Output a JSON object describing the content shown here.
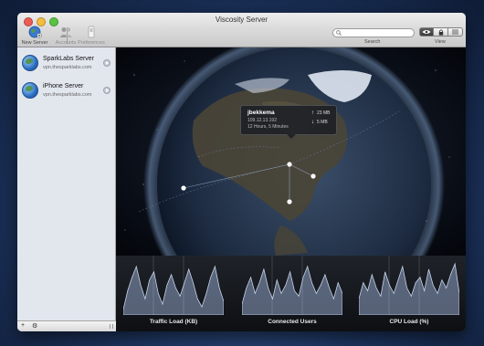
{
  "window": {
    "title": "Viscosity Server"
  },
  "toolbar": {
    "new_server_label": "New Server",
    "accounts_label": "Accounts",
    "preferences_label": "Preferences",
    "search_placeholder": "",
    "search_label": "Search",
    "view_label": "View"
  },
  "sidebar": {
    "servers": [
      {
        "name": "SparkLabs Server",
        "host": "vpn.thesparklabs.com"
      },
      {
        "name": "iPhone Server",
        "host": "vpn.thesparklabs.com"
      }
    ],
    "add_label": "+",
    "gear_label": "⚙"
  },
  "popup": {
    "user": "jbekkema",
    "ip": "109.12.13.192",
    "duration": "12 Hours, 5 Minutes",
    "up": "23 MB",
    "down": "5 MB"
  },
  "charts": {
    "traffic": {
      "title": "Traffic Load (KB)",
      "values": [
        0.1,
        0.45,
        0.7,
        0.9,
        0.55,
        0.3,
        0.65,
        0.8,
        0.4,
        0.2,
        0.55,
        0.75,
        0.5,
        0.35,
        0.6,
        0.85,
        0.6,
        0.3,
        0.15,
        0.4,
        0.7,
        0.9,
        0.5,
        0.25
      ]
    },
    "users": {
      "title": "Connected Users",
      "values": [
        0.2,
        0.5,
        0.7,
        0.4,
        0.6,
        0.85,
        0.5,
        0.3,
        0.65,
        0.4,
        0.55,
        0.8,
        0.45,
        0.35,
        0.7,
        0.9,
        0.6,
        0.4,
        0.55,
        0.75,
        0.5,
        0.3,
        0.6,
        0.4
      ]
    },
    "cpu": {
      "title": "CPU Load (%)",
      "values": [
        0.3,
        0.6,
        0.45,
        0.75,
        0.5,
        0.35,
        0.8,
        0.55,
        0.4,
        0.65,
        0.9,
        0.5,
        0.35,
        0.6,
        0.7,
        0.45,
        0.85,
        0.55,
        0.4,
        0.65,
        0.5,
        0.75,
        0.95,
        0.4
      ]
    }
  },
  "colors": {
    "chart_fill": "#8fa2c4",
    "chart_line": "#c7d4ec"
  }
}
